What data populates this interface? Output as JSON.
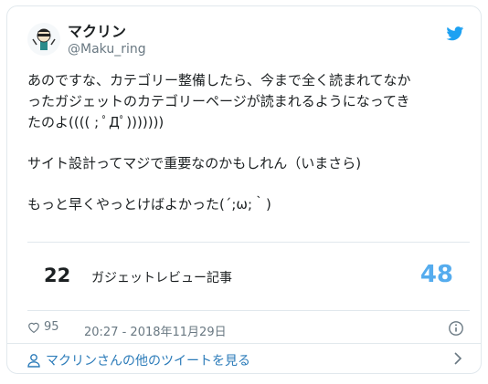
{
  "tweet": {
    "author": {
      "name": "マクリン",
      "handle": "@Maku_ring"
    },
    "lines": [
      "あのですな、カテゴリー整備したら、今まで全く読まれてなか",
      "ったガジェットのカテゴリーページが読まれるようになってき",
      "たのよ(((( ; ﾟДﾟ)))))))",
      "サイト設計ってマジで重要なのかもしれん（いまさら)",
      "もっと早くやっとけばよかった(´;ω;｀)"
    ],
    "quote": {
      "left": "22",
      "middle": "ガジェットレビュー記事",
      "right": "48"
    },
    "likes": "95",
    "timestamp": "20:27 - 2018年11月29日",
    "more_link": "マクリンさんの他のツイートを見る"
  },
  "colors": {
    "link": "#2b7bb9",
    "accent": "#55acee",
    "border": "#e1e8ed",
    "muted": "#697882"
  },
  "icons": [
    "avatar",
    "twitter-bird-icon",
    "heart-icon",
    "info-icon",
    "person-icon",
    "chevron-right-icon"
  ]
}
